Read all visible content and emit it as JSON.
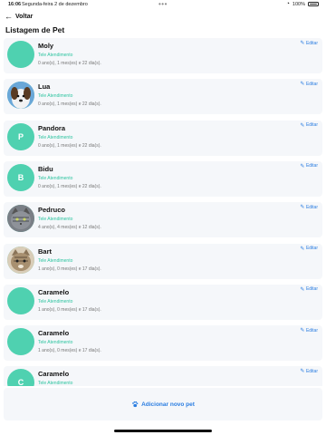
{
  "status": {
    "time": "16:06",
    "date": "Segunda-feira 2 de dezembro",
    "dots": "•••",
    "battery": "100%"
  },
  "nav": {
    "back_label": "Voltar"
  },
  "page": {
    "title": "Listagem de Pet"
  },
  "pets": [
    {
      "name": "Moly",
      "type": "Tele Atendimento",
      "age": "0 ano(s), 1 mes(es) e 22 dia(s).",
      "initial": "",
      "photo": "none"
    },
    {
      "name": "Lua",
      "type": "Tele Atendimento",
      "age": "0 ano(s), 1 mes(es) e 22 dia(s).",
      "initial": "",
      "photo": "dog"
    },
    {
      "name": "Pandora",
      "type": "Tele Atendimento",
      "age": "0 ano(s), 1 mes(es) e 22 dia(s).",
      "initial": "P",
      "photo": "none"
    },
    {
      "name": "Bidu",
      "type": "Tele Atendimento",
      "age": "0 ano(s), 1 mes(es) e 22 dia(s).",
      "initial": "B",
      "photo": "none"
    },
    {
      "name": "Pedruco",
      "type": "Tele Atendimento",
      "age": "4 ano(s), 4 mes(es) e 12 dia(s).",
      "initial": "",
      "photo": "cat-gray"
    },
    {
      "name": "Bart",
      "type": "Tele Atendimento",
      "age": "1 ano(s), 0 mes(es) e 17 dia(s).",
      "initial": "",
      "photo": "cat-tabby"
    },
    {
      "name": "Caramelo",
      "type": "Tele Atendimento",
      "age": "1 ano(s), 0 mes(es) e 17 dia(s).",
      "initial": "",
      "photo": "none"
    },
    {
      "name": "Caramelo",
      "type": "Tele Atendimento",
      "age": "1 ano(s), 0 mes(es) e 17 dia(s).",
      "initial": "",
      "photo": "none"
    },
    {
      "name": "Caramelo",
      "type": "Tele Atendimento",
      "age": "",
      "initial": "C",
      "photo": "none"
    }
  ],
  "edit_label": "Editar",
  "add_label": "Adicionar novo pet",
  "colors": {
    "accent": "#2a7de1",
    "avatar": "#4fd1b0",
    "type_text": "#2ec4a0"
  }
}
